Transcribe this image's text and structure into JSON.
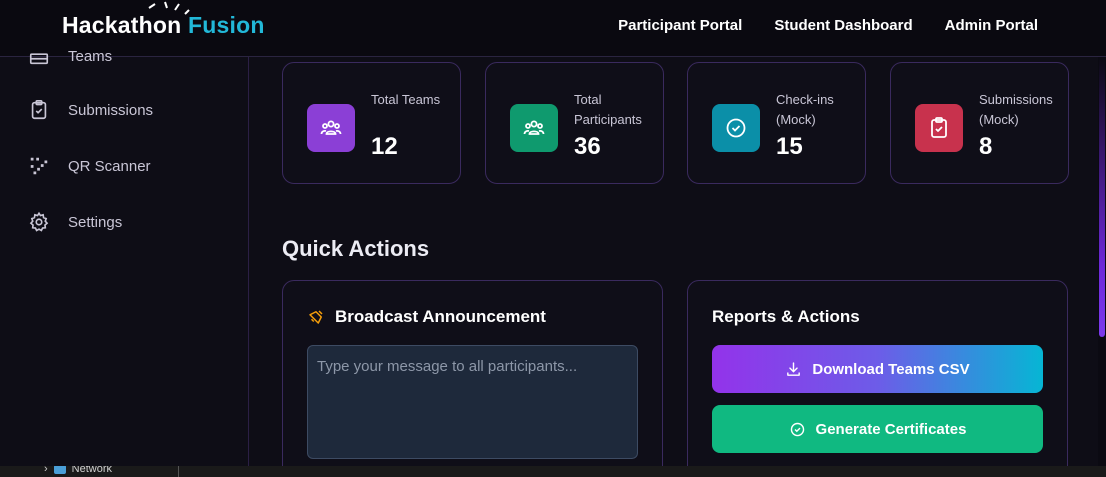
{
  "header": {
    "logo_main": "Hackathon",
    "logo_accent": "Fusion",
    "nav": [
      "Participant Portal",
      "Student Dashboard",
      "Admin Portal"
    ]
  },
  "sidebar": {
    "items": [
      {
        "label": "Teams",
        "icon": "teams-icon"
      },
      {
        "label": "Submissions",
        "icon": "clipboard-check-icon"
      },
      {
        "label": "QR Scanner",
        "icon": "qr-scan-icon"
      },
      {
        "label": "Settings",
        "icon": "gear-icon"
      }
    ]
  },
  "stats": [
    {
      "label": "Total Teams",
      "value": "12",
      "icon": "users-icon",
      "color": "#8b3fd6"
    },
    {
      "label": "Total Participants",
      "value": "36",
      "icon": "users-icon",
      "color": "#0f9a6e"
    },
    {
      "label": "Check-ins (Mock)",
      "value": "15",
      "icon": "check-circle-icon",
      "color": "#0b8fa8"
    },
    {
      "label": "Submissions (Mock)",
      "value": "8",
      "icon": "clipboard-check-icon",
      "color": "#c8324d"
    }
  ],
  "quick_actions": {
    "title": "Quick Actions",
    "broadcast": {
      "title": "Broadcast Announcement",
      "placeholder": "Type your message to all participants..."
    },
    "reports": {
      "title": "Reports & Actions",
      "download_label": "Download Teams CSV",
      "certificates_label": "Generate Certificates"
    }
  },
  "taskbar": {
    "item_label": "Network"
  },
  "colors": {
    "accent_cyan": "#22b8d8",
    "accent_purple": "#9333ea",
    "success": "#10b981",
    "background": "#0e0d16"
  }
}
